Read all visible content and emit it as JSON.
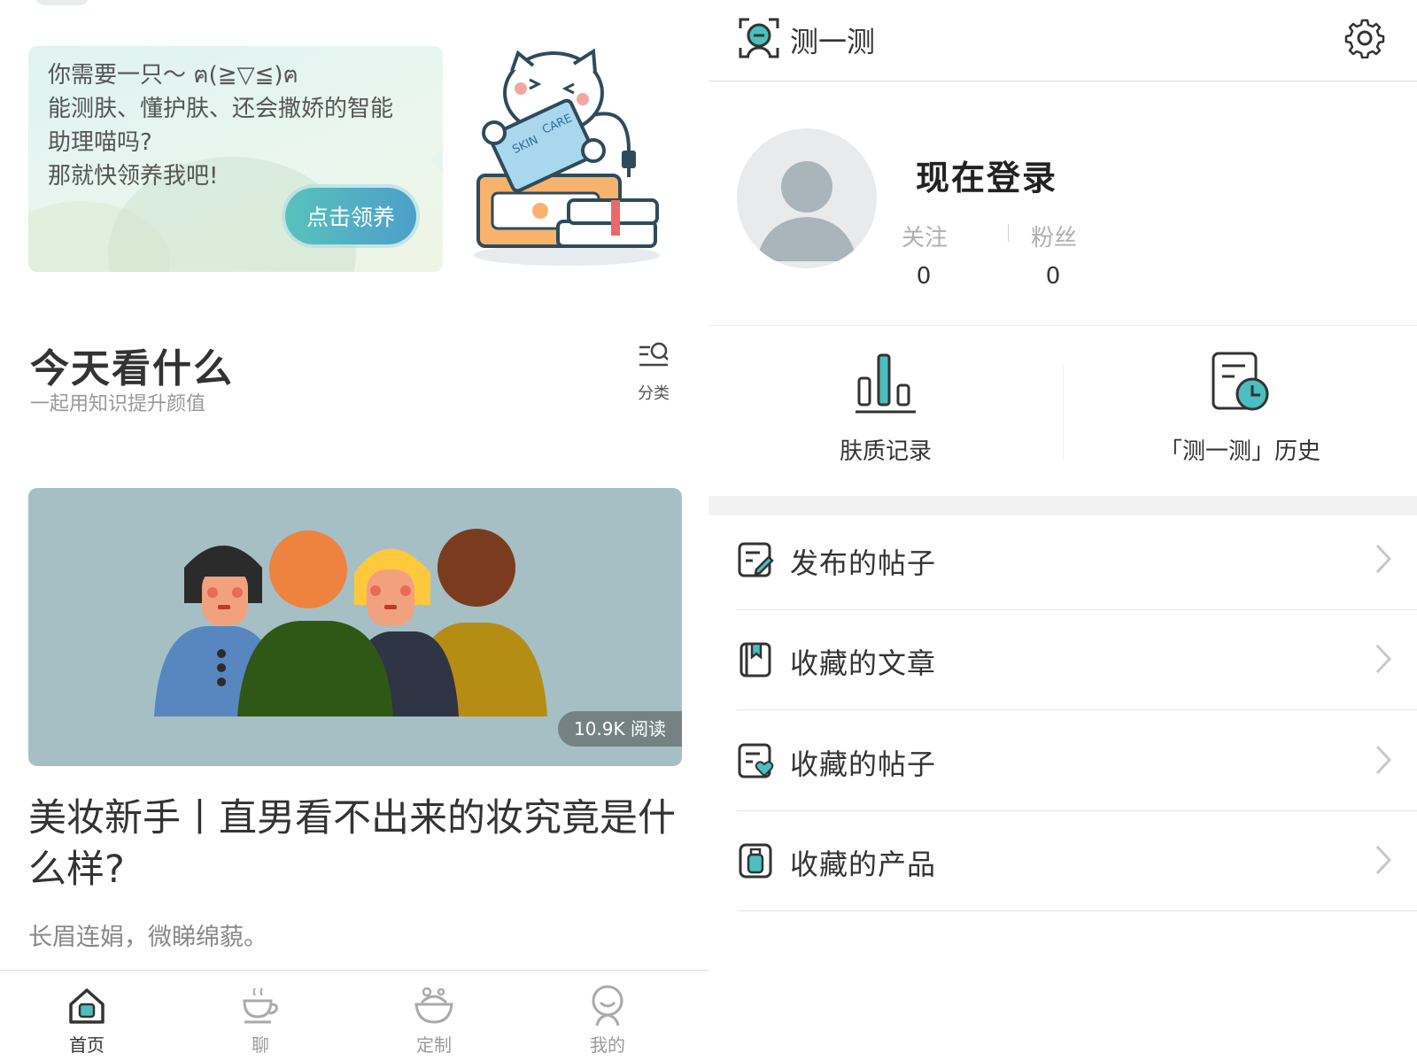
{
  "home": {
    "promo": {
      "lines": [
        "你需要一只～ ฅ(≧▽≦)ฅ",
        "能测肤、懂护肤、还会撒娇的智能",
        "助理喵吗?",
        "那就快领养我吧!"
      ],
      "button": "点击领养",
      "illustration_labels": [
        "SKIN",
        "CARE"
      ]
    },
    "section": {
      "title": "今天看什么",
      "subtitle": "一起用知识提升颜值",
      "category_label": "分类"
    },
    "article": {
      "reads": "10.9K 阅读",
      "title": "美妆新手丨直男看不出来的妆究竟是什么样?",
      "desc": "长眉连娟，微睇绵藐。"
    },
    "tabs": [
      {
        "label": "首页",
        "icon": "home-icon",
        "active": true
      },
      {
        "label": "聊",
        "icon": "coffee-cup-icon",
        "active": false
      },
      {
        "label": "定制",
        "icon": "bowl-icon",
        "active": false
      },
      {
        "label": "我的",
        "icon": "person-icon",
        "active": false
      }
    ]
  },
  "profile": {
    "header_title": "测一测",
    "login": "现在登录",
    "follow_label": "关注",
    "follow_count": "0",
    "fans_label": "粉丝",
    "fans_count": "0",
    "quick": [
      {
        "label": "肤质记录",
        "icon": "bar-chart-icon"
      },
      {
        "label": "「测一测」历史",
        "icon": "history-clock-icon"
      }
    ],
    "menu": [
      {
        "label": "发布的帖子",
        "icon": "edit-post-icon"
      },
      {
        "label": "收藏的文章",
        "icon": "bookmark-book-icon"
      },
      {
        "label": "收藏的帖子",
        "icon": "heart-post-icon"
      },
      {
        "label": "收藏的产品",
        "icon": "bottle-icon"
      }
    ]
  },
  "colors": {
    "accent": "#4bbfbf",
    "adopt_button": "#57c2bd",
    "text_dark": "#333333",
    "text_muted": "#999999"
  }
}
